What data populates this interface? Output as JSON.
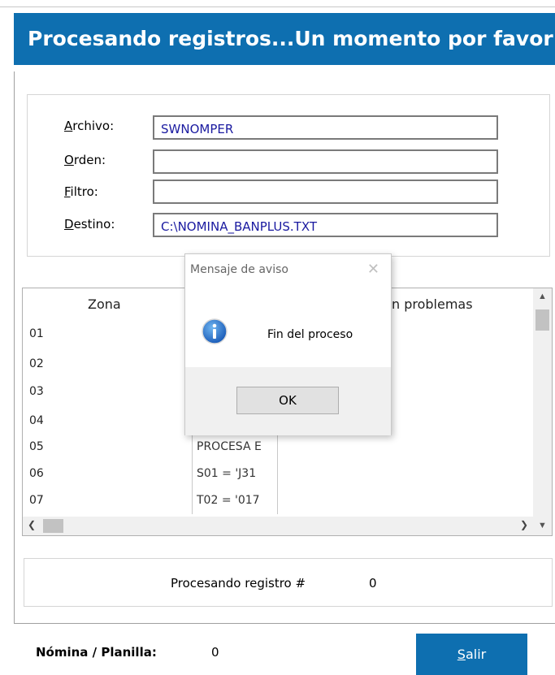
{
  "header": {
    "title": "Procesando registros...Un momento por favor"
  },
  "fields": [
    {
      "hotkey": "A",
      "rest": "rchivo:",
      "value": "SWNOMPER"
    },
    {
      "hotkey": "O",
      "rest": "rden:",
      "value": ""
    },
    {
      "hotkey": "F",
      "rest": "iltro:",
      "value": ""
    },
    {
      "hotkey": "D",
      "rest": "estino:",
      "value": "C:\\NOMINA_BANPLUS.TXT"
    }
  ],
  "grid": {
    "columns": [
      "Zona",
      "n problemas"
    ],
    "rows": [
      "01",
      "02",
      "03",
      "04",
      "05",
      "06",
      "07"
    ],
    "cells": [
      "PROCESA E",
      "S01 = 'J31",
      "T02 = '017"
    ]
  },
  "status": {
    "label": "Procesando registro #",
    "value": "0"
  },
  "footer": {
    "label": "Nómina / Planilla:",
    "value": "0",
    "exit_hotkey": "S",
    "exit_rest": "alir"
  },
  "dialog": {
    "title": "Mensaje de aviso",
    "close": "✕",
    "message": "Fin del proceso",
    "ok": "OK"
  },
  "icons": {
    "dialog_icon": "info-icon",
    "brand_color": "#0e6fb0"
  }
}
